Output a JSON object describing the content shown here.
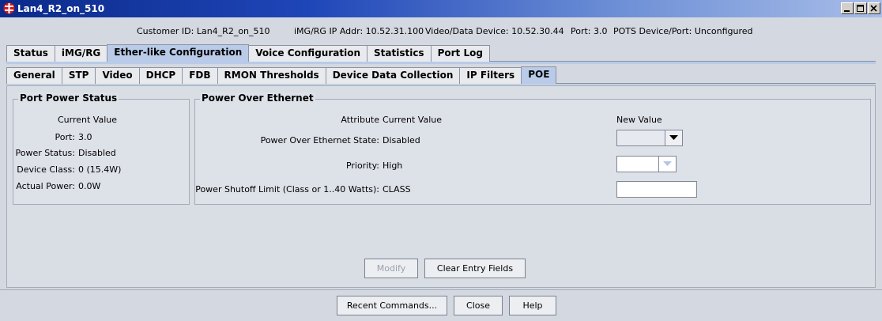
{
  "window": {
    "title": "Lan4_R2_on_510",
    "icons": [
      "app-icon",
      "minimize-icon",
      "maximize-icon",
      "close-icon"
    ]
  },
  "info": {
    "customer": "Customer ID: Lan4_R2_on_510",
    "img_ip": "iMG/RG IP Addr: 10.52.31.100",
    "video_device": "Video/Data Device: 10.52.30.44",
    "port": "Port: 3.0",
    "pots": "POTS Device/Port: Unconfigured"
  },
  "main_tabs": [
    "Status",
    "iMG/RG",
    "Ether-like Configuration",
    "Voice Configuration",
    "Statistics",
    "Port Log"
  ],
  "sub_tabs": [
    "General",
    "STP",
    "Video",
    "DHCP",
    "FDB",
    "RMON Thresholds",
    "Device Data Collection",
    "IP Filters",
    "POE"
  ],
  "port_power_status": {
    "title": "Port Power Status",
    "header": "Current Value",
    "rows": [
      {
        "label": "Port:",
        "value": "3.0"
      },
      {
        "label": "Power Status:",
        "value": "Disabled"
      },
      {
        "label": "Device Class:",
        "value": "0 (15.4W)"
      },
      {
        "label": "Actual Power:",
        "value": "0.0W"
      }
    ]
  },
  "poe": {
    "title": "Power Over Ethernet",
    "attr_header": "Attribute",
    "current_header": "Current Value",
    "new_header": "New Value",
    "rows": [
      {
        "label": "Power Over Ethernet State:",
        "value": "Disabled"
      },
      {
        "label": "Priority:",
        "value": "High"
      },
      {
        "label": "Power Shutoff Limit (Class or 1..40 Watts):",
        "value": "CLASS"
      }
    ]
  },
  "buttons": {
    "modify": "Modify",
    "clear": "Clear Entry Fields",
    "recent": "Recent Commands...",
    "close": "Close",
    "help": "Help"
  },
  "colors": {
    "titlebar": "#1f46b8",
    "active_tab": "#b9cbe8",
    "app_icon": "#d01818"
  }
}
